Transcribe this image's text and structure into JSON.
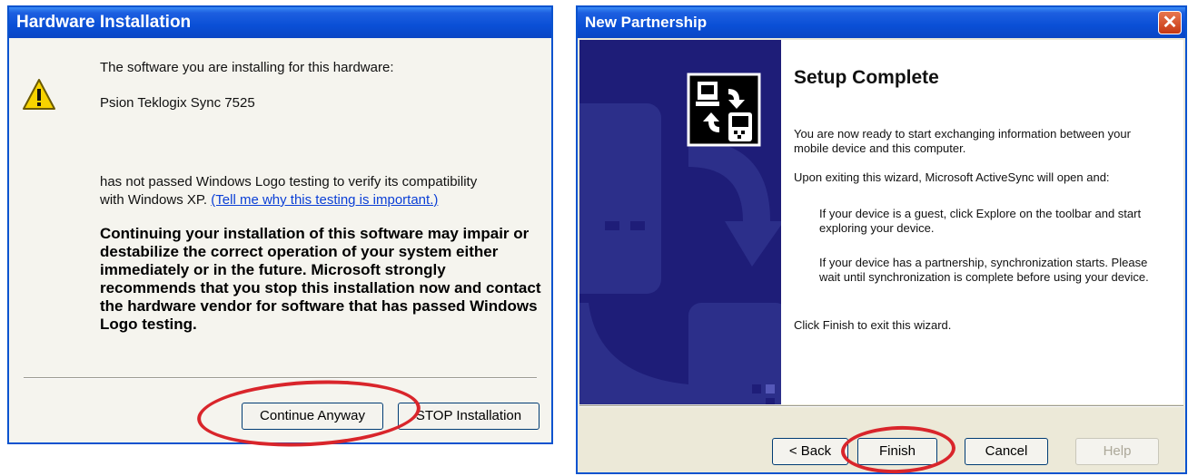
{
  "hardware_dialog": {
    "title": "Hardware Installation",
    "line1": "The software you are installing for this hardware:",
    "device_name": "Psion Teklogix Sync 7525",
    "line2": "has not passed Windows Logo testing to verify its compatibility",
    "line3_prefix": "with Windows XP. ",
    "link": "(Tell me why this testing is important.)",
    "warning": "Continuing your installation of this software may impair or destabilize the correct operation of your system either immediately or in the future. Microsoft strongly recommends that you stop this installation now and contact the hardware vendor for software that has passed Windows Logo testing.",
    "continue_label": "Continue Anyway",
    "stop_label": "STOP Installation"
  },
  "partnership_dialog": {
    "title": "New Partnership",
    "close_glyph": "✕",
    "heading": "Setup Complete",
    "p1": "You are now ready to start exchanging information between your mobile device and this computer.",
    "p2": "Upon exiting this wizard, Microsoft ActiveSync will open and:",
    "p3": "If your device is a guest, click Explore on the toolbar and start exploring your device.",
    "p4": "If your device has a partnership, synchronization starts. Please wait until synchronization is complete before using your device.",
    "p5": "Click Finish to exit this wizard.",
    "back_label": "< Back",
    "finish_label": "Finish",
    "cancel_label": "Cancel",
    "help_label": "Help"
  },
  "colors": {
    "title_bar": "#0a4fd6",
    "highlight_ellipse": "#d9252b",
    "wizard_side": "#1e1d78"
  },
  "icons": [
    "warning-icon",
    "sync-devices-icon",
    "close-icon"
  ]
}
